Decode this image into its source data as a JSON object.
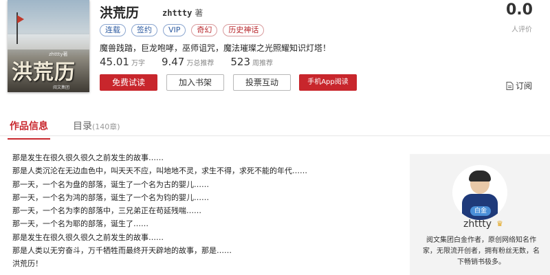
{
  "book": {
    "title": "洪荒历",
    "author": "zhttty",
    "author_suffix": "著",
    "cover": {
      "title": "洪荒历",
      "author": "zhttty著",
      "publisher": "阅文集团"
    },
    "tags": [
      {
        "label": "连载",
        "color": "blue"
      },
      {
        "label": "签约",
        "color": "blue"
      },
      {
        "label": "VIP",
        "color": "blue"
      },
      {
        "label": "奇幻",
        "color": "red"
      },
      {
        "label": "历史神话",
        "color": "red"
      }
    ],
    "intro": "魔兽践踏，巨龙咆哮，巫师诅咒，魔法璀璨之光照耀知识灯塔！",
    "stats": [
      {
        "value": "45.01",
        "unit": "万字"
      },
      {
        "value": "9.47",
        "unit": "万总推荐"
      },
      {
        "value": "523",
        "unit": "周推荐"
      }
    ],
    "score": "0.0",
    "rating_count": "人评价"
  },
  "actions": {
    "read": "免费试读",
    "shelf": "加入书架",
    "vote": "投票互动",
    "app": "手机App阅读",
    "subscribe": "订阅"
  },
  "tabs": {
    "info": "作品信息",
    "toc": "目录",
    "toc_count": "(140章)"
  },
  "synopsis": [
    "那是发生在很久很久很久之前发生的故事……",
    "那是人类沉沦在无边血色中，叫天天不应，叫地地不灵，求生不得，求死不能的年代……",
    "那一天，一个名为盘的部落，诞生了一个名为古的婴儿……",
    "那一天，一个名为鸿的部落，诞生了一个名为钧的婴儿……",
    "那一天，一个名为李的部落中，三兄弟正在苟延残喘……",
    "那一天，一个名为耶的部落，诞生了……",
    "那是发生在很久很久很久之前发生的故事……",
    "那是人类以无穷奋斗，万千牺牲而最终开天辟地的故事，那是……",
    "洪荒历！"
  ],
  "author_card": {
    "name": "zhttty",
    "badge": "白金",
    "bio": "阅文集团白金作者，原创网络知名作家，无限流开创者，拥有粉丝无数，名下畅销书极多。"
  },
  "colors": {
    "accent": "#c8262c",
    "tag_blue": "#2c5aa0",
    "tag_red": "#b8262b"
  }
}
